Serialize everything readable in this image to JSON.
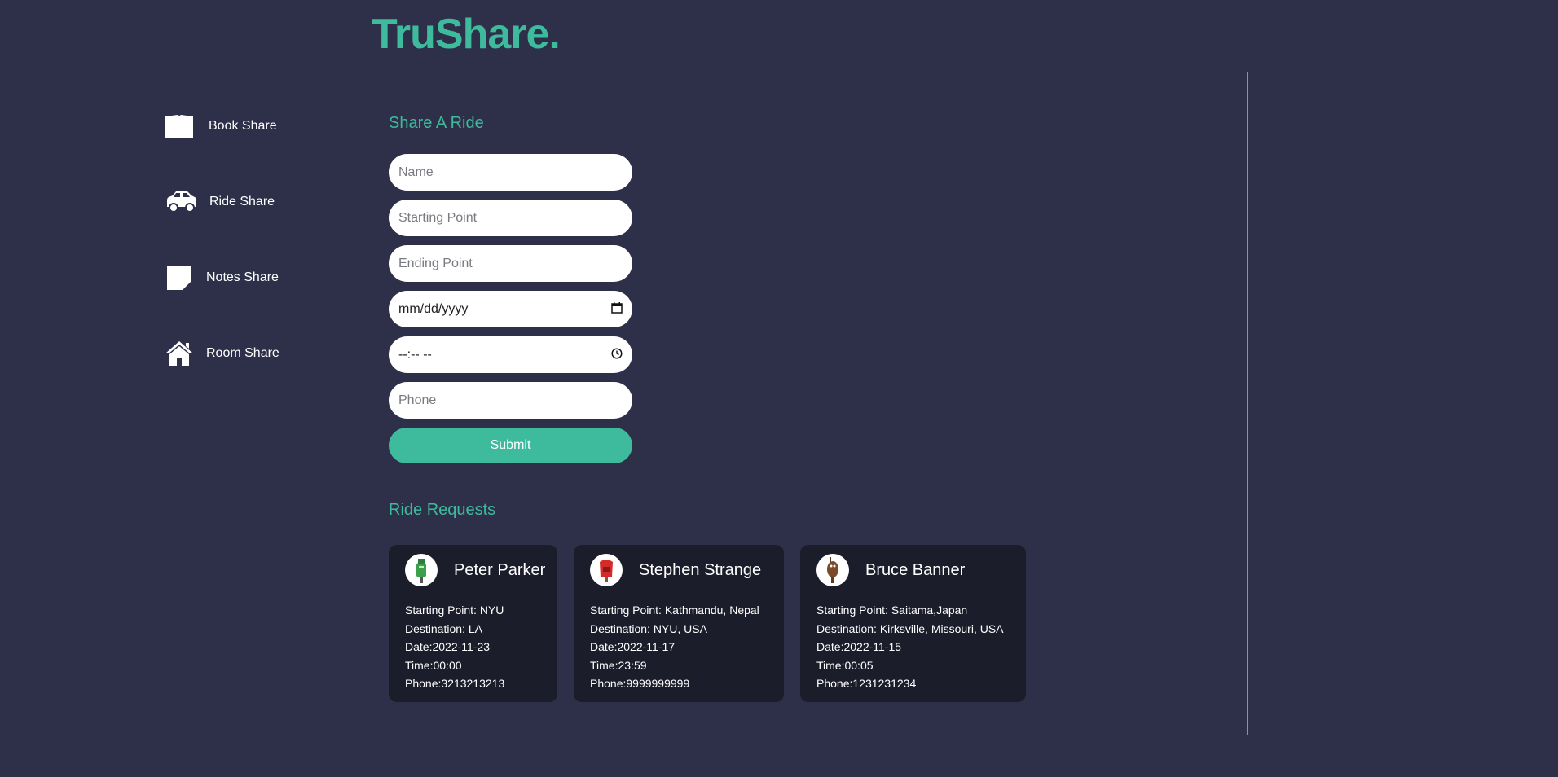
{
  "brand": {
    "logo": "TruShare."
  },
  "sidebar": {
    "items": [
      {
        "label": "Book Share",
        "icon": "book-icon"
      },
      {
        "label": "Ride Share",
        "icon": "car-icon"
      },
      {
        "label": "Notes Share",
        "icon": "note-icon"
      },
      {
        "label": "Room Share",
        "icon": "house-icon"
      }
    ]
  },
  "form": {
    "title": "Share A Ride",
    "name_placeholder": "Name",
    "start_placeholder": "Starting Point",
    "end_placeholder": "Ending Point",
    "date_placeholder": "mm/dd/yyyy",
    "time_placeholder": "--:-- --",
    "phone_placeholder": "Phone",
    "submit_label": "Submit"
  },
  "requests": {
    "title": "Ride Requests",
    "cards": [
      {
        "name": "Peter Parker",
        "avatar_color": "#3aa04a",
        "start": "Starting Point: NYU",
        "destination": "Destination: LA",
        "date": "Date:2022-11-23",
        "time": "Time:00:00",
        "phone": "Phone:3213213213"
      },
      {
        "name": "Stephen Strange",
        "avatar_color": "#d42a2a",
        "start": "Starting Point: Kathmandu, Nepal",
        "destination": "Destination: NYU, USA",
        "date": "Date:2022-11-17",
        "time": "Time:23:59",
        "phone": "Phone:9999999999"
      },
      {
        "name": "Bruce Banner",
        "avatar_color": "#7a4a2a",
        "start": "Starting Point: Saitama,Japan",
        "destination": "Destination: Kirksville, Missouri, USA",
        "date": "Date:2022-11-15",
        "time": "Time:00:05",
        "phone": "Phone:1231231234"
      }
    ]
  },
  "colors": {
    "background": "#2e2f48",
    "accent": "#3dbb9c",
    "card": "#1c1d2b"
  }
}
